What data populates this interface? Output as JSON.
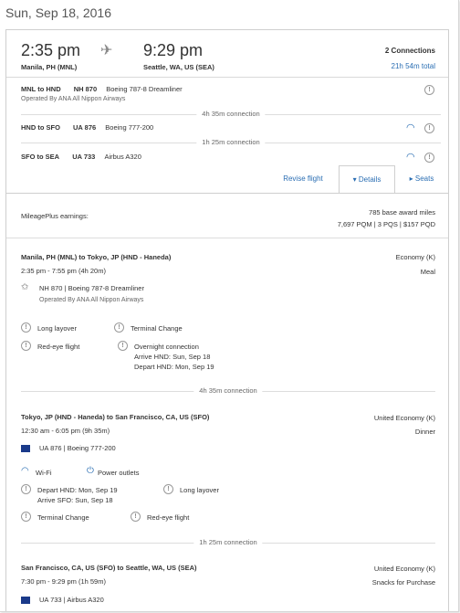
{
  "date": "Sun, Sep 18, 2016",
  "summary": {
    "depart_time": "2:35 pm",
    "arrive_time": "9:29 pm",
    "depart_city": "Manila, PH (MNL)",
    "arrive_city": "Seattle, WA, US (SEA)",
    "connections": "2 Connections",
    "total_time": "21h 54m total"
  },
  "segments": [
    {
      "route": "MNL to HND",
      "flight": "NH 870",
      "aircraft": "Boeing 787-8 Dreamliner",
      "operated": "Operated By ANA All Nippon Airways"
    },
    {
      "route": "HND to SFO",
      "flight": "UA 876",
      "aircraft": "Boeing 777-200",
      "operated": ""
    },
    {
      "route": "SFO to SEA",
      "flight": "UA 733",
      "aircraft": "Airbus A320",
      "operated": ""
    }
  ],
  "layovers": [
    "4h 35m connection",
    "1h 25m connection"
  ],
  "tabs": {
    "revise": "Revise flight",
    "details": "▾ Details",
    "seats": "▸ Seats"
  },
  "mileage": {
    "label": "MileagePlus earnings:",
    "award": "785 base award miles",
    "pqm": "7,697 PQM | 3 PQS | $157 PQD"
  },
  "details": [
    {
      "route": "Manila, PH (MNL) to Tokyo, JP (HND - Haneda)",
      "cabin": "Economy (K)",
      "time": "2:35 pm - 7:55 pm (4h 20m)",
      "meal": "Meal",
      "flight": "NH 870",
      "aircraft": "Boeing 787-8 Dreamliner",
      "operated": "Operated By ANA All Nippon Airways",
      "notes": {
        "long_layover": "Long layover",
        "terminal_change": "Terminal Change",
        "red_eye": "Red-eye flight",
        "overnight": "Overnight connection",
        "arrive": "Arrive HND: Sun, Sep 18",
        "depart": "Depart HND: Mon, Sep 19"
      }
    },
    {
      "route": "Tokyo, JP (HND - Haneda) to San Francisco, CA, US (SFO)",
      "cabin": "United Economy (K)",
      "time": "12:30 am - 6:05 pm (9h 35m)",
      "meal": "Dinner",
      "flight": "UA 876",
      "aircraft": "Boeing 777-200",
      "notes": {
        "wifi": "Wi-Fi",
        "power": "Power outlets",
        "depart": "Depart HND: Mon, Sep 19",
        "arrive": "Arrive SFO: Sun, Sep 18",
        "long_layover": "Long layover",
        "terminal_change": "Terminal Change",
        "red_eye": "Red-eye flight"
      }
    },
    {
      "route": "San Francisco, CA, US (SFO) to Seattle, WA, US (SEA)",
      "cabin": "United Economy (K)",
      "time": "7:30 pm - 9:29 pm (1h 59m)",
      "meal": "Snacks for Purchase",
      "flight": "UA 733",
      "aircraft": "Airbus A320"
    }
  ]
}
